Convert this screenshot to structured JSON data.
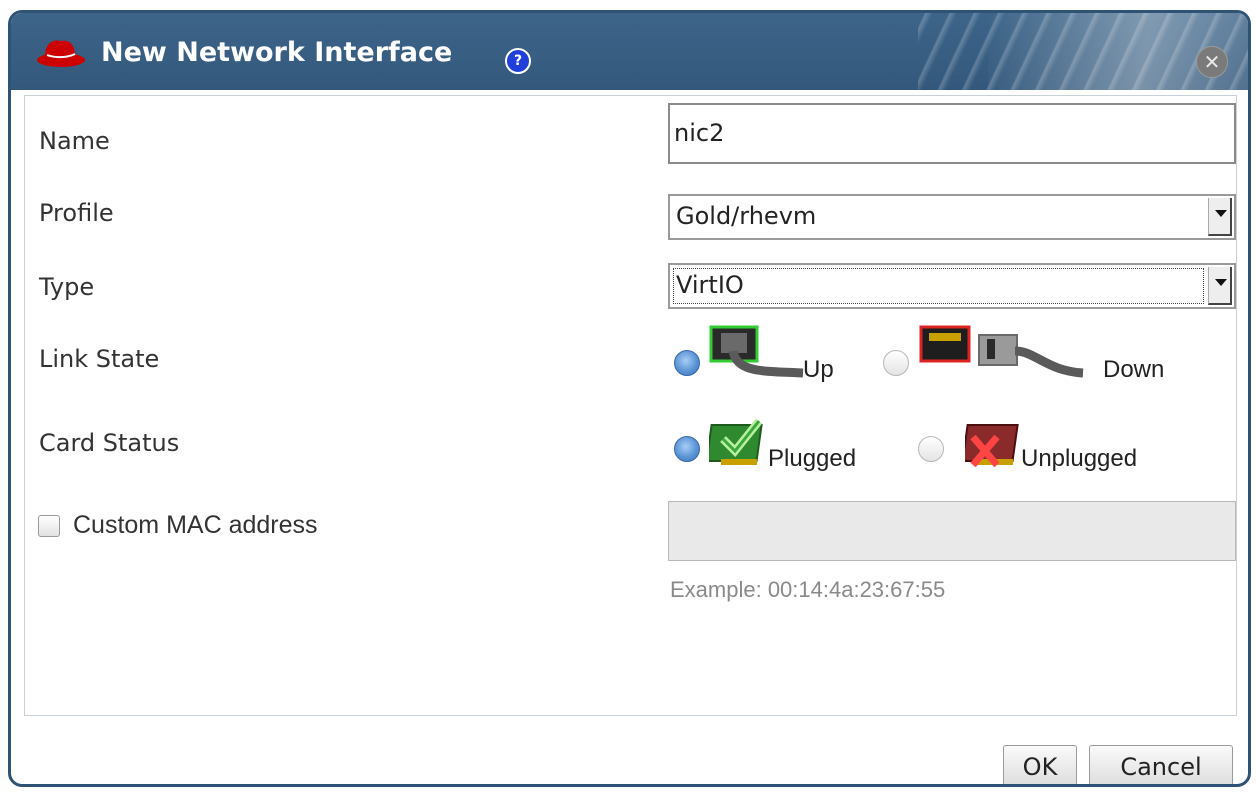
{
  "dialog": {
    "title": "New Network Interface",
    "help_symbol": "?",
    "close_symbol": "✕"
  },
  "form": {
    "name_label": "Name",
    "name_value": "nic2",
    "profile_label": "Profile",
    "profile_value": "Gold/rhevm",
    "type_label": "Type",
    "type_value": "VirtIO",
    "link_state_label": "Link State",
    "link_state_options": [
      {
        "label": "Up",
        "checked": true,
        "icon": "network-cable-plugged-icon"
      },
      {
        "label": "Down",
        "checked": false,
        "icon": "network-cable-unplugged-icon"
      }
    ],
    "card_status_label": "Card Status",
    "card_status_options": [
      {
        "label": "Plugged",
        "checked": true,
        "icon": "nic-card-plugged-icon"
      },
      {
        "label": "Unplugged",
        "checked": false,
        "icon": "nic-card-unplugged-icon"
      }
    ],
    "custom_mac_label": "Custom MAC address",
    "custom_mac_checked": false,
    "mac_value": "",
    "mac_example": "Example: 00:14:4a:23:67:55"
  },
  "buttons": {
    "ok": "OK",
    "cancel": "Cancel"
  },
  "colors": {
    "titlebar": "#33587c",
    "dialog_border": "#2f5375",
    "logo_red": "#cc0000",
    "help_blue": "#1f3fd8"
  }
}
